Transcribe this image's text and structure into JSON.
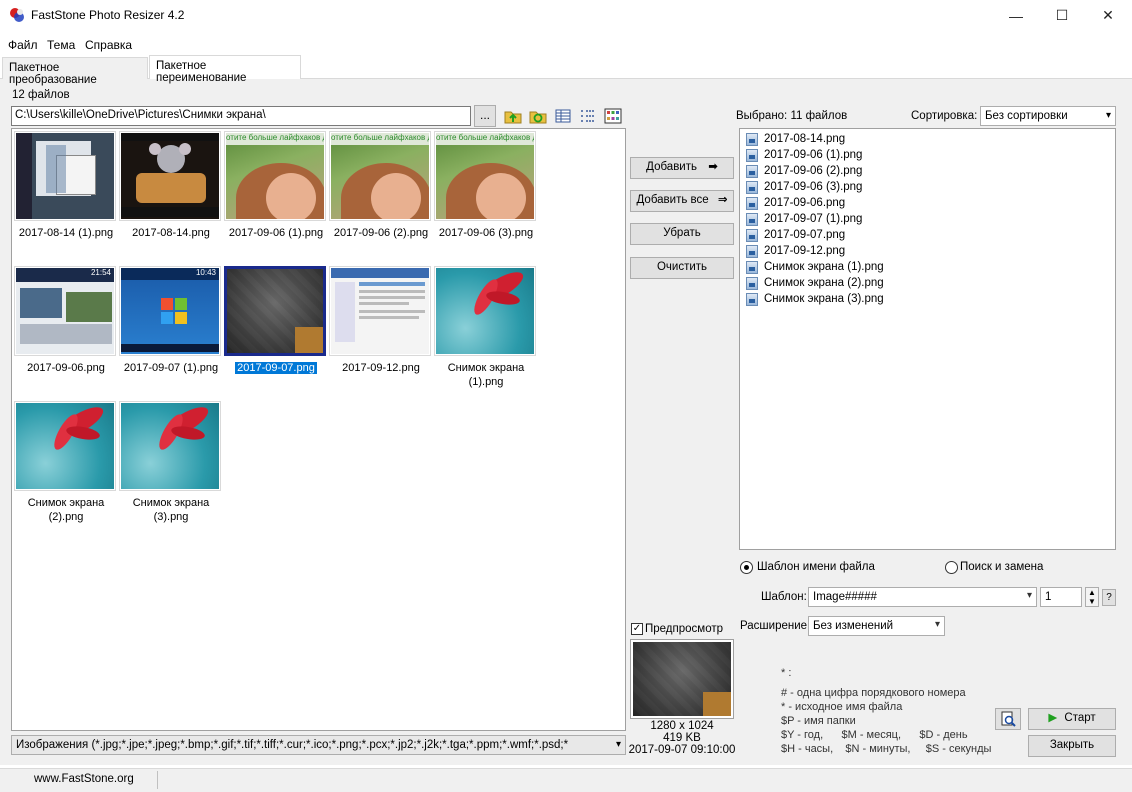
{
  "window": {
    "title": "FastStone Photo Resizer 4.2",
    "minimize": "—",
    "maximize": "☐",
    "close": "✕"
  },
  "menu": [
    "Файл",
    "Тема",
    "Справка"
  ],
  "tabs": [
    "Пакетное преобразование",
    "Пакетное переименование"
  ],
  "left": {
    "file_count": "12 файлов",
    "path": "C:\\Users\\kille\\OneDrive\\Pictures\\Снимки экрана\\",
    "browse": "...",
    "filter": "Изображения (*.jpg;*.jpe;*.jpeg;*.bmp;*.gif;*.tif;*.tiff;*.cur;*.ico;*.png;*.pcx;*.jp2;*.j2k;*.tga;*.ppm;*.wmf;*.psd;*"
  },
  "thumbnails": [
    {
      "label": "2017-08-14 (1).png"
    },
    {
      "label": "2017-08-14.png"
    },
    {
      "label": "2017-09-06 (1).png",
      "overlay": "отите больше лайфхаков для н"
    },
    {
      "label": "2017-09-06 (2).png",
      "overlay": "отите больше лайфхаков для н"
    },
    {
      "label": "2017-09-06 (3).png",
      "overlay": "отите больше лайфхаков для н"
    },
    {
      "label": "2017-09-06.png",
      "overlay": "21:54"
    },
    {
      "label": "2017-09-07 (1).png",
      "overlay": "10:43"
    },
    {
      "label": "2017-09-07.png",
      "selected": true
    },
    {
      "label": "2017-09-12.png"
    },
    {
      "label": "Снимок экрана (1).png"
    },
    {
      "label": "Снимок экрана (2).png"
    },
    {
      "label": "Снимок экрана (3).png"
    }
  ],
  "middle": {
    "add": "Добавить",
    "add_all": "Добавить все",
    "remove": "Убрать",
    "clear": "Очистить",
    "preview_label": "Предпросмотр",
    "preview_dims": "1280 x 1024",
    "preview_size": "419 KB",
    "preview_date": "2017-09-07 09:10:00"
  },
  "right": {
    "selected": "Выбрано:  11 файлов",
    "sort_label": "Сортировка:",
    "sort_value": "Без сортировки",
    "files": [
      "2017-08-14.png",
      "2017-09-06 (1).png",
      "2017-09-06 (2).png",
      "2017-09-06 (3).png",
      "2017-09-06.png",
      "2017-09-07 (1).png",
      "2017-09-07.png",
      "2017-09-12.png",
      "Снимок экрана (1).png",
      "Снимок экрана (2).png",
      "Снимок экрана (3).png"
    ],
    "radio_template": "Шаблон имени файла",
    "radio_search": "Поиск и замена",
    "template_label": "Шаблон:",
    "template_value": "Image#####",
    "start_number": "1",
    "help_q": "?",
    "ext_label": "Расширение:",
    "ext_value": "Без изменений",
    "help_lines": [
      "* :",
      "#  - одна цифра порядкового номера",
      "*  - исходное имя файла",
      "$P - имя папки",
      "$Y - год,      $M - месяц,      $D - день",
      "$H - часы,    $N - минуты,     $S - секунды"
    ],
    "start": "Старт",
    "close": "Закрыть"
  },
  "status": {
    "url": "www.FastStone.org"
  }
}
